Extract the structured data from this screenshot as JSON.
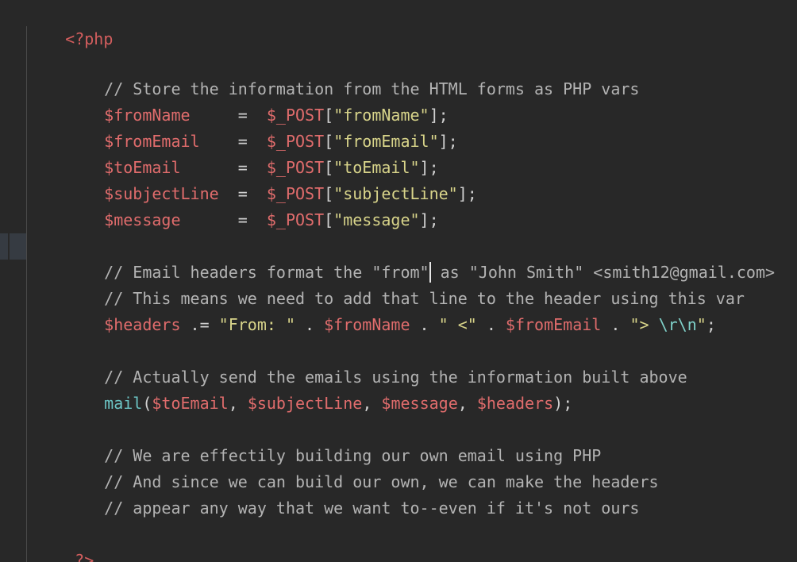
{
  "code": {
    "open_tag": "<?php",
    "close_tag": "?>",
    "comment_store": "// Store the information from the HTML forms as PHP vars",
    "assign": {
      "fromName": {
        "var": "$fromName",
        "pad": "     ",
        "eq": "=  ",
        "post": "$_POST",
        "lb": "[",
        "key": "\"fromName\"",
        "rb": "];"
      },
      "fromEmail": {
        "var": "$fromEmail",
        "pad": "    ",
        "eq": "=  ",
        "post": "$_POST",
        "lb": "[",
        "key": "\"fromEmail\"",
        "rb": "];"
      },
      "toEmail": {
        "var": "$toEmail",
        "pad": "      ",
        "eq": "=  ",
        "post": "$_POST",
        "lb": "[",
        "key": "\"toEmail\"",
        "rb": "];"
      },
      "subjectLine": {
        "var": "$subjectLine",
        "pad": "  ",
        "eq": "=  ",
        "post": "$_POST",
        "lb": "[",
        "key": "\"subjectLine\"",
        "rb": "];"
      },
      "message": {
        "var": "$message",
        "pad": "      ",
        "eq": "=  ",
        "post": "$_POST",
        "lb": "[",
        "key": "\"message\"",
        "rb": "];"
      }
    },
    "comment_headers_1a": "// Email headers format the \"from\"",
    "comment_headers_1b": " as \"John Smith\" <smith12@gmail.com>",
    "comment_headers_2": "// This means we need to add that line to the header using this var",
    "headers_line": {
      "var": "$headers",
      "op": " .= ",
      "str1": "\"From: \"",
      "dot1": " . ",
      "v1": "$fromName",
      "dot2": " . ",
      "str2": "\" <\"",
      "dot3": " . ",
      "v2": "$fromEmail",
      "dot4": " . ",
      "str3a": "\"> ",
      "esc": "\\r\\n",
      "str3b": "\"",
      "semi": ";"
    },
    "comment_send": "// Actually send the emails using the information built above",
    "mail_line": {
      "fn": "mail",
      "open": "(",
      "a1": "$toEmail",
      "c1": ", ",
      "a2": "$subjectLine",
      "c2": ", ",
      "a3": "$message",
      "c3": ", ",
      "a4": "$headers",
      "close": ");"
    },
    "comment_end_1": "// We are effectily building our own email using PHP",
    "comment_end_2": "// And since we can build our own, we can make the headers",
    "comment_end_3": "// appear any way that we want to--even if it's not ours"
  },
  "colors": {
    "background": "#282828",
    "keyword": "#d35e5e",
    "variable": "#e06c6c",
    "string": "#d8d48a",
    "comment": "#b3b3b3",
    "function": "#6cc4c4"
  }
}
